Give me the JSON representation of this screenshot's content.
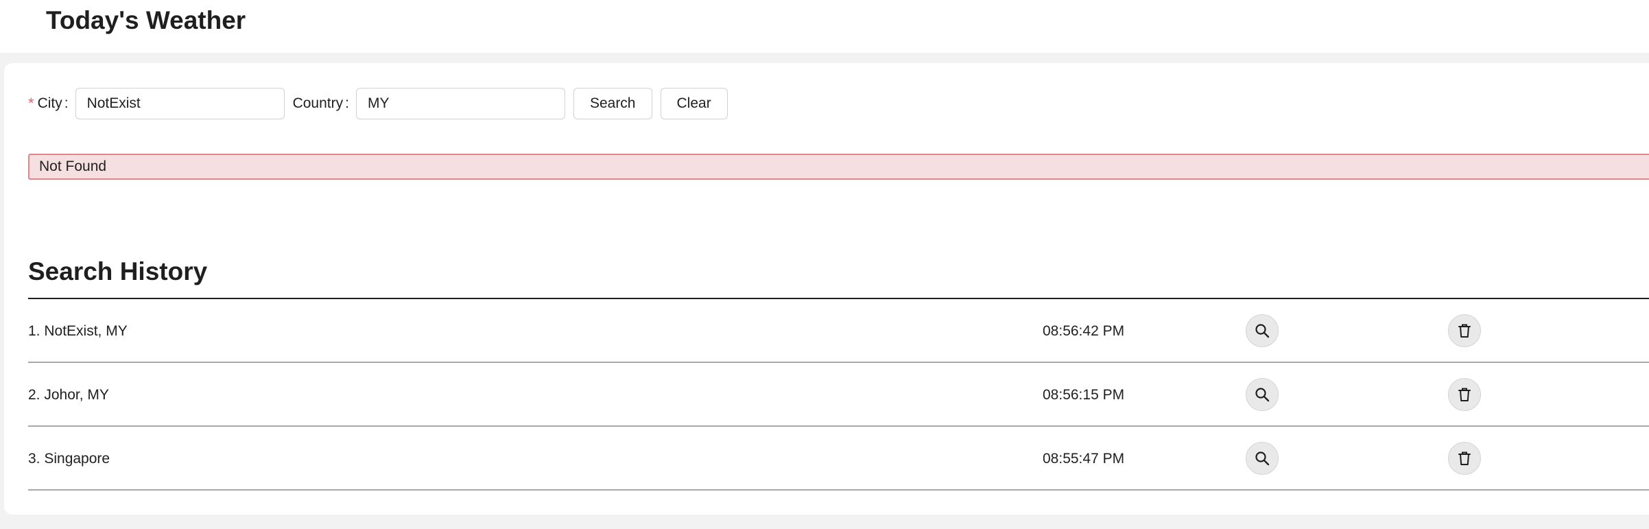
{
  "header": {
    "title": "Today's Weather"
  },
  "form": {
    "required_mark": "*",
    "city_label": "City",
    "city_value": "NotExist",
    "country_label": "Country",
    "country_value": "MY",
    "colon": ":",
    "search_label": "Search",
    "clear_label": "Clear"
  },
  "alert": {
    "message": "Not Found"
  },
  "history": {
    "title": "Search History",
    "items": [
      {
        "label": "1. NotExist, MY",
        "time": "08:56:42 PM"
      },
      {
        "label": "2. Johor, MY",
        "time": "08:56:15 PM"
      },
      {
        "label": "3. Singapore",
        "time": "08:55:47 PM"
      }
    ],
    "search_icon": "search-icon",
    "delete_icon": "trash-icon"
  },
  "colors": {
    "error_bg": "#f5dfe0",
    "error_border": "#e0868b",
    "required": "#e06666"
  }
}
